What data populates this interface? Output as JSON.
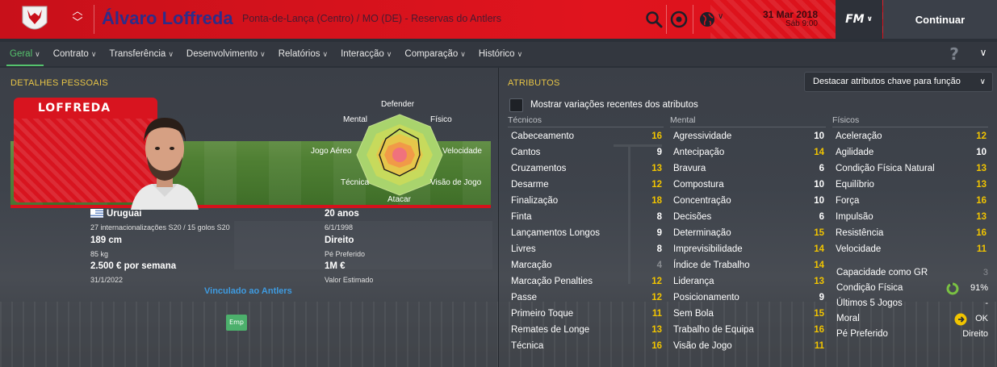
{
  "header": {
    "player_name": "Álvaro Loffreda",
    "subtitle": "Ponta-de-Lança (Centro) / MO (DE) - Reservas do Antlers",
    "date": "31 Mar 2018",
    "time": "Sáb 9:00",
    "fm_label": "FM",
    "continue_label": "Continuar"
  },
  "nav": {
    "tabs": [
      {
        "label": "Geral"
      },
      {
        "label": "Contrato"
      },
      {
        "label": "Transferência"
      },
      {
        "label": "Desenvolvimento"
      },
      {
        "label": "Relatórios"
      },
      {
        "label": "Interacção"
      },
      {
        "label": "Comparação"
      },
      {
        "label": "Histórico"
      }
    ],
    "help_label": "?"
  },
  "personal": {
    "title": "DETALHES PESSOAIS",
    "kit_name": "LOFFREDA",
    "radar_labels": {
      "top": "Defender",
      "top_left": "Mental",
      "top_right": "Físico",
      "left": "Jogo Aéreo",
      "right": "Velocidade",
      "bottom_left": "Técnica",
      "bottom_right": "Visão de Jogo",
      "bottom": "Atacar"
    },
    "nationality": "Uruguai",
    "caps": "27 internacionalizações S20 / 15 golos S20",
    "height": "189 cm",
    "weight": "85 kg",
    "wage": "2.500 € por semana",
    "contract_end": "31/1/2022",
    "age": "20 anos",
    "birth_date": "6/1/1998",
    "preferred_foot": "Direito",
    "preferred_foot_label": "Pé Preferido",
    "value": "1M €",
    "value_label": "Valor Estimado",
    "link_text": "Vinculado ao Antlers",
    "emp_label": "Emp"
  },
  "attributes": {
    "title": "ATRIBUTOS",
    "dropdown_label": "Destacar atributos chave para função",
    "checkbox_label": "Mostrar variações recentes dos atributos",
    "colors": {
      "highlight": "#f1c400",
      "normal": "#ffffff",
      "low": "#8a8d92"
    },
    "technical": {
      "header": "Técnicos",
      "items": [
        {
          "name": "Cabeceamento",
          "value": "16",
          "tone": "y"
        },
        {
          "name": "Cantos",
          "value": "9",
          "tone": "w"
        },
        {
          "name": "Cruzamentos",
          "value": "13",
          "tone": "y"
        },
        {
          "name": "Desarme",
          "value": "12",
          "tone": "y"
        },
        {
          "name": "Finalização",
          "value": "18",
          "tone": "y"
        },
        {
          "name": "Finta",
          "value": "8",
          "tone": "w"
        },
        {
          "name": "Lançamentos Longos",
          "value": "9",
          "tone": "w"
        },
        {
          "name": "Livres",
          "value": "8",
          "tone": "w"
        },
        {
          "name": "Marcação",
          "value": "4",
          "tone": "g"
        },
        {
          "name": "Marcação Penalties",
          "value": "12",
          "tone": "y"
        },
        {
          "name": "Passe",
          "value": "12",
          "tone": "y"
        },
        {
          "name": "Primeiro Toque",
          "value": "11",
          "tone": "y"
        },
        {
          "name": "Remates de Longe",
          "value": "13",
          "tone": "y"
        },
        {
          "name": "Técnica",
          "value": "16",
          "tone": "y"
        }
      ]
    },
    "mental": {
      "header": "Mental",
      "items": [
        {
          "name": "Agressividade",
          "value": "10",
          "tone": "w"
        },
        {
          "name": "Antecipação",
          "value": "14",
          "tone": "y"
        },
        {
          "name": "Bravura",
          "value": "6",
          "tone": "w"
        },
        {
          "name": "Compostura",
          "value": "10",
          "tone": "w"
        },
        {
          "name": "Concentração",
          "value": "10",
          "tone": "w"
        },
        {
          "name": "Decisões",
          "value": "6",
          "tone": "w"
        },
        {
          "name": "Determinação",
          "value": "15",
          "tone": "y"
        },
        {
          "name": "Imprevisibilidade",
          "value": "14",
          "tone": "y"
        },
        {
          "name": "Índice de Trabalho",
          "value": "14",
          "tone": "y"
        },
        {
          "name": "Liderança",
          "value": "13",
          "tone": "y"
        },
        {
          "name": "Posicionamento",
          "value": "9",
          "tone": "w"
        },
        {
          "name": "Sem Bola",
          "value": "15",
          "tone": "y"
        },
        {
          "name": "Trabalho de Equipa",
          "value": "16",
          "tone": "y"
        },
        {
          "name": "Visão de Jogo",
          "value": "11",
          "tone": "y"
        }
      ]
    },
    "physical": {
      "header": "Físicos",
      "items": [
        {
          "name": "Aceleração",
          "value": "12",
          "tone": "y"
        },
        {
          "name": "Agilidade",
          "value": "10",
          "tone": "w"
        },
        {
          "name": "Condição Física Natural",
          "value": "13",
          "tone": "y"
        },
        {
          "name": "Equilíbrio",
          "value": "13",
          "tone": "y"
        },
        {
          "name": "Força",
          "value": "16",
          "tone": "y"
        },
        {
          "name": "Impulsão",
          "value": "13",
          "tone": "y"
        },
        {
          "name": "Resistência",
          "value": "16",
          "tone": "y"
        },
        {
          "name": "Velocidade",
          "value": "11",
          "tone": "y"
        }
      ]
    },
    "side": [
      {
        "name": "Capacidade como GR",
        "value": "3"
      },
      {
        "name": "Condição Física",
        "value": "91%"
      },
      {
        "name": "Últimos 5 Jogos",
        "value": "-"
      },
      {
        "name": "Moral",
        "value": "OK"
      },
      {
        "name": "Pé Preferido",
        "value": "Direito"
      }
    ],
    "condition_fraction": 0.91
  }
}
